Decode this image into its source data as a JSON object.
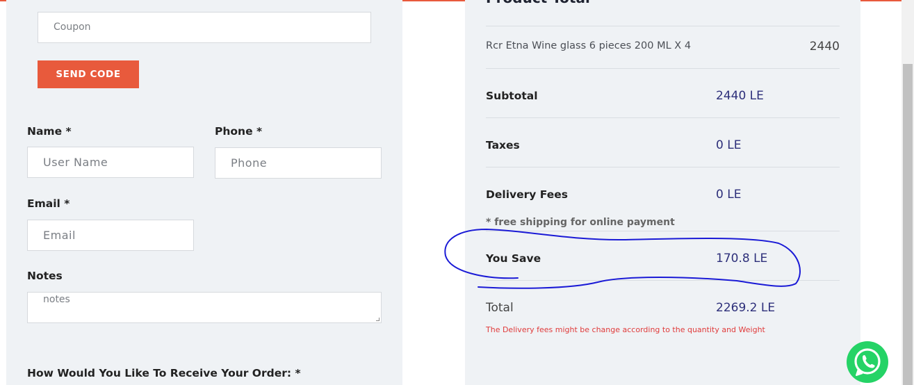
{
  "form": {
    "coupon_placeholder": "Coupon",
    "send_code_label": "SEND CODE",
    "name_label": "Name *",
    "name_placeholder": "User Name",
    "phone_label": "Phone *",
    "phone_placeholder": "Phone",
    "email_label": "Email *",
    "email_placeholder": "Email",
    "notes_label": "Notes",
    "notes_placeholder": "notes",
    "receive_label": "How Would You Like To Receive Your Order: *"
  },
  "summary": {
    "title": "Product Total",
    "item_name": "Rcr Etna Wine glass 6 pieces 200 ML X 4",
    "item_price": "2440",
    "subtotal_label": "Subtotal",
    "subtotal_value": "2440 LE",
    "taxes_label": "Taxes",
    "taxes_value": "0 LE",
    "delivery_label": "Delivery Fees",
    "delivery_value": "0 LE",
    "free_shipping_note": "* free shipping for online payment",
    "save_label": "You Save",
    "save_value": "170.8 LE",
    "total_label": "Total",
    "total_value": "2269.2 LE",
    "delivery_warning": "The Delivery fees might be change according to the quantity and Weight"
  },
  "colors": {
    "accent": "#e85a3c",
    "value_text": "#2d2f7a",
    "warning": "#e03b3b",
    "whatsapp": "#25d366",
    "annotation_ink": "#1a1ad6"
  },
  "icons": {
    "whatsapp": "whatsapp-icon"
  }
}
